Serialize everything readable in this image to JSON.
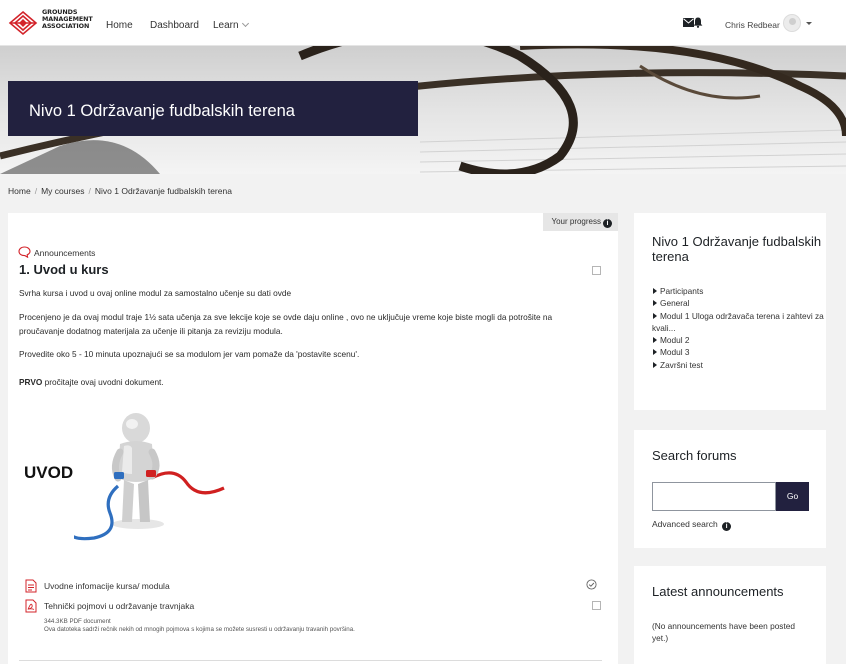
{
  "brand": {
    "logo_lines": [
      "GROUNDS",
      "MANAGEMENT",
      "ASSOCIATION"
    ],
    "accent_color": "#d3232a"
  },
  "nav": {
    "home": "Home",
    "dashboard": "Dashboard",
    "learn": "Learn",
    "user_name": "Chris Redbear",
    "icons": [
      "envelope-icon",
      "bell-icon",
      "avatar",
      "caret-down-icon"
    ]
  },
  "hero": {
    "title": "Nivo 1 Održavanje fudbalskih terena",
    "title_bg": "#22213f"
  },
  "breadcrumb": [
    "Home",
    "My courses",
    "Nivo 1 Održavanje fudbalskih terena"
  ],
  "main": {
    "progress_label": "Your progress",
    "announcements_label": "Announcements",
    "section_title": "1. Uvod u kurs",
    "paragraphs": [
      "Svrha kursa i uvod u ovaj online modul za samostalno učenje su dati ovde",
      "Procenjeno je da ovaj modul traje 1½ sata učenja za sve lekcije koje se ovde daju online , ovo ne uključuje vreme koje biste mogli da potrošite na proučavanje dodatnog materijala za učenje ili pitanja za reviziju  modula.",
      "Provedite oko 5 - 10 minuta upoznajući se sa modulom jer vam pomaže da 'postavite scenu'."
    ],
    "first_bold": "PRVO",
    "first_rest": " pročitajte ovaj uvodni dokument.",
    "image_label": "UVOD",
    "activities": [
      {
        "label": "Uvodne infomacije kursa/ modula",
        "completed": true
      },
      {
        "label": "Tehnički pojmovi u održavanje travnjaka",
        "completed": false
      }
    ],
    "file_meta": "344.3KB PDF document",
    "file_description": "Ova datoteka sadrži rečnik  nekih od mnogih pojmova s kojima se možete susresti u održavanju travanih površina."
  },
  "sidebar": {
    "course": {
      "title": "Nivo 1 Održavanje fudbalskih terena",
      "items": [
        "Participants",
        "General",
        "Modul 1 Uloga održavača terena i zahtevi za kvali...",
        "Modul 2",
        "Modul 3",
        "Završni test"
      ]
    },
    "search": {
      "title": "Search forums",
      "go": "Go",
      "advanced": "Advanced search"
    },
    "announcements": {
      "title": "Latest announcements",
      "text": "(No announcements have been posted yet.)"
    }
  }
}
